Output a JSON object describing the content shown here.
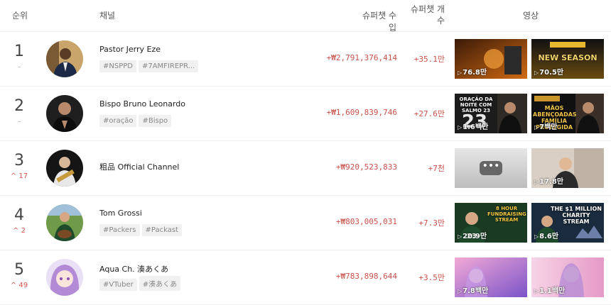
{
  "header": {
    "rank": "순위",
    "channel": "채널",
    "income": "슈퍼챗 수입",
    "count_line1": "슈퍼챗 개",
    "count_line2": "수",
    "video": "영상"
  },
  "rows": [
    {
      "rank": "1",
      "change": "–",
      "name": "Pastor Jerry Eze",
      "tags": [
        "#NSPPD",
        "#7AMFIREPR..."
      ],
      "income": "+₩2,791,376,414",
      "count": "+35.1만",
      "videos": [
        {
          "views": "76.8만",
          "caption": ""
        },
        {
          "views": "70.5만",
          "caption": "NEW SEASON"
        }
      ]
    },
    {
      "rank": "2",
      "change": "–",
      "name": "Bispo Bruno Leonardo",
      "tags": [
        "#oração",
        "#Bispo"
      ],
      "income": "+₩1,609,839,746",
      "count": "+27.6만",
      "videos": [
        {
          "views": "1.6백만",
          "caption": "ORAÇÃO DA NOITE COM SALMO 23"
        },
        {
          "views": "7백만",
          "caption": "MÃOS ABENÇOADAS FAMÍLIA PROTEGIDA"
        }
      ]
    },
    {
      "rank": "3",
      "change": "17",
      "name": "粗品 Official Channel",
      "tags": [],
      "income": "+₩920,523,833",
      "count": "+7천",
      "videos": [
        {
          "views": "",
          "caption": ""
        },
        {
          "views": "17.8만",
          "caption": ""
        }
      ]
    },
    {
      "rank": "4",
      "change": "2",
      "name": "Tom Grossi",
      "tags": [
        "#Packers",
        "#Packast"
      ],
      "income": "+₩803,005,031",
      "count": "+7.3만",
      "videos": [
        {
          "views": "20.9만",
          "caption": "8 HOUR FUNDRAISING STREAM"
        },
        {
          "views": "8.6만",
          "caption": "THE $1 MILLION CHARITY STREAM"
        }
      ]
    },
    {
      "rank": "5",
      "change": "49",
      "name": "Aqua Ch. 湊あくあ",
      "tags": [
        "#VTuber",
        "#湊あくあ"
      ],
      "income": "+₩783,898,644",
      "count": "+3.5만",
      "videos": [
        {
          "views": "7.8백만",
          "caption": ""
        },
        {
          "views": "1.1백만",
          "caption": ""
        }
      ]
    }
  ],
  "icons": {
    "up_arrow": "^",
    "play": "▷",
    "more": "•••"
  }
}
